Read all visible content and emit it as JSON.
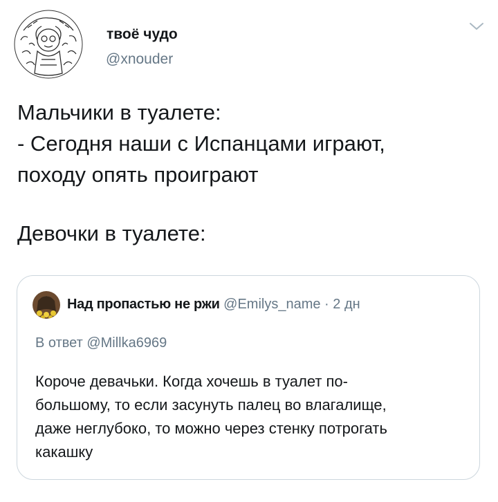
{
  "author": {
    "display_name": "твоё чудо",
    "handle": "@xnouder",
    "avatar_icon": "sketch-avatar-icon"
  },
  "tweet": {
    "lines_block1": [
      "Мальчики в туалете:",
      "- Сегодня наши с Испанцами играют,",
      "походу опять проиграют"
    ],
    "lines_block2": [
      "Девочки в туалете:"
    ]
  },
  "quoted_tweet": {
    "display_name": "Над пропастью не ржи",
    "handle": "@Emilys_name",
    "separator": "·",
    "time": "2 дн",
    "reply_prefix": "В ответ",
    "reply_to": "@Millka6969",
    "body_lines": [
      "Короче девачьки. Когда хочешь в туалет по-",
      "большому, то если засунуть палец во влагалище,",
      "даже неглубоко, то можно через стенку потрогать",
      "какашку"
    ]
  },
  "colors": {
    "text": "#14171a",
    "secondary": "#657786",
    "border": "#ccd6dd"
  }
}
